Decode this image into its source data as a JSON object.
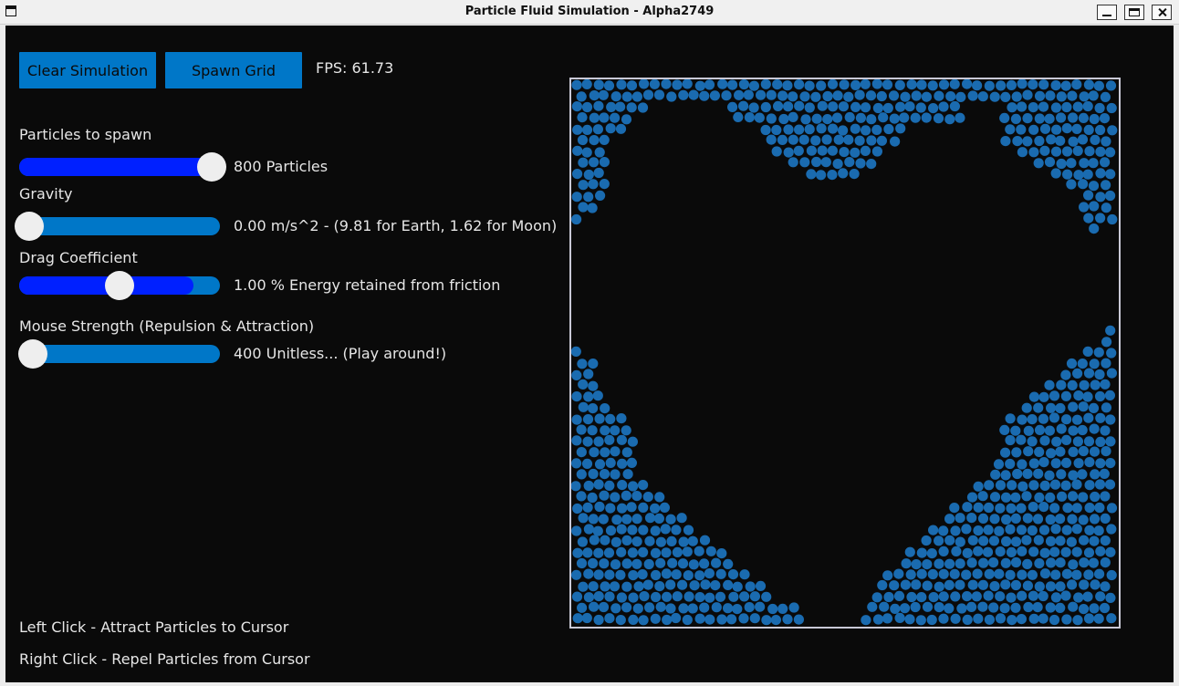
{
  "window": {
    "title": "Particle Fluid Simulation - Alpha2749"
  },
  "toolbar": {
    "clear_label": "Clear Simulation",
    "spawn_label": "Spawn Grid",
    "fps_text": "FPS: 61.73"
  },
  "sliders": [
    {
      "name": "particles",
      "label": "Particles to spawn",
      "value_text": "800 Particles",
      "fraction": 0.96,
      "fill": 0.96
    },
    {
      "name": "gravity",
      "label": "Gravity",
      "value_text": "0.00 m/s^2 - (9.81 for Earth, 1.62 for Moon)",
      "fraction": 0.05,
      "fill": 0.0
    },
    {
      "name": "drag",
      "label": "Drag Coefficient",
      "value_text": "1.00 % Energy retained from friction",
      "fraction": 0.5,
      "fill": 0.87
    },
    {
      "name": "mouse",
      "label": "Mouse Strength (Repulsion & Attraction)",
      "value_text": "400 Unitless... (Play around!)",
      "fraction": 0.07,
      "fill": 0.07
    }
  ],
  "help": {
    "left_click": "Left Click - Attract Particles to Cursor",
    "right_click": "Right Click - Repel Particles from Cursor"
  },
  "colors": {
    "particle": "#1a6bb0",
    "button_bg": "#0077c8",
    "slider_fill": "#0020ff",
    "slider_track": "#0077c8",
    "background": "#0a0a0a",
    "container_border": "#c9c9d6"
  }
}
